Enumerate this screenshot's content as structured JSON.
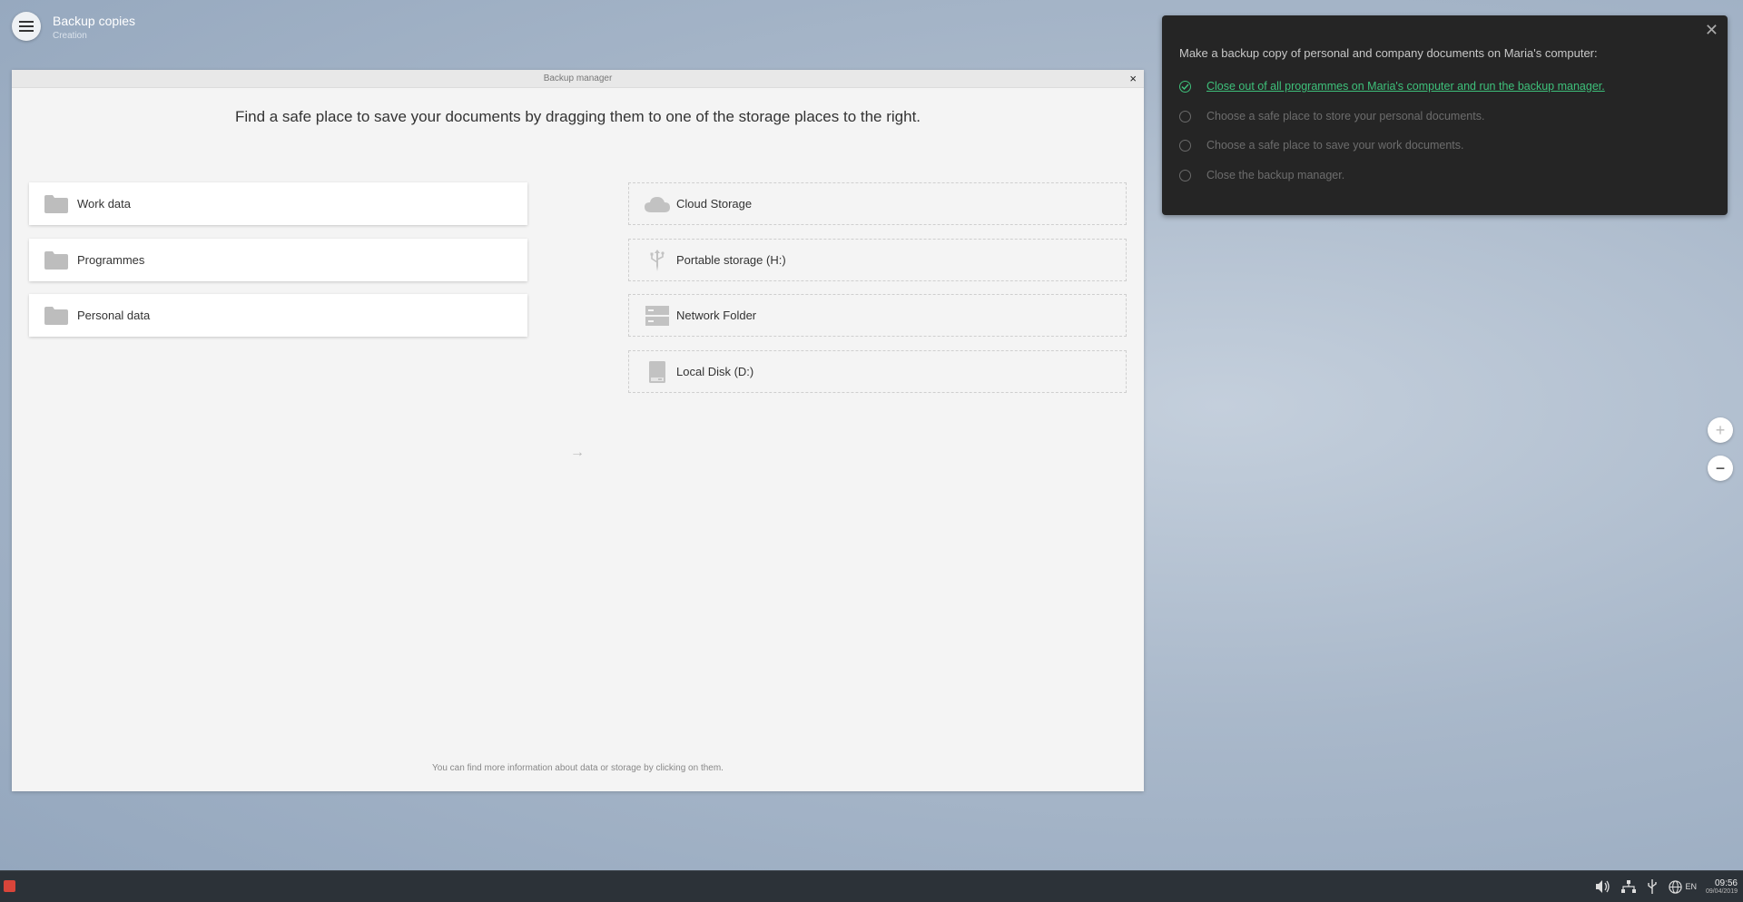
{
  "app": {
    "title": "Backup copies",
    "subtitle": "Creation"
  },
  "window": {
    "title": "Backup manager",
    "close_glyph": "×",
    "instruction": "Find a safe place to save your documents by dragging them to one of the storage places to the right.",
    "footer": "You can find more information about data or storage by clicking on them.",
    "items": [
      {
        "label": "Work data",
        "icon": "folder-icon"
      },
      {
        "label": "Programmes",
        "icon": "folder-icon"
      },
      {
        "label": "Personal data",
        "icon": "folder-icon"
      }
    ],
    "storage": [
      {
        "label": "Cloud Storage",
        "icon": "cloud-icon"
      },
      {
        "label": "Portable storage (H:)",
        "icon": "usb-icon"
      },
      {
        "label": "Network Folder",
        "icon": "server-icon"
      },
      {
        "label": "Local Disk (D:)",
        "icon": "disk-icon"
      }
    ]
  },
  "tasks": {
    "title": "Make a backup copy of personal and company documents on Maria's computer:",
    "close_glyph": "✕",
    "items": [
      {
        "label": "Close out of all programmes on Maria's computer and run the backup manager.",
        "done": true
      },
      {
        "label": "Choose a safe place to store your personal documents.",
        "done": false
      },
      {
        "label": "Choose a safe place to save your work documents.",
        "done": false
      },
      {
        "label": "Close the backup manager.",
        "done": false
      }
    ]
  },
  "zoom": {
    "in": "+",
    "out": "−"
  },
  "taskbar": {
    "lang": "EN",
    "time": "09:56",
    "date": "09/04/2019"
  },
  "colors": {
    "accent_done": "#3ec07a",
    "panel_bg": "#252525"
  }
}
